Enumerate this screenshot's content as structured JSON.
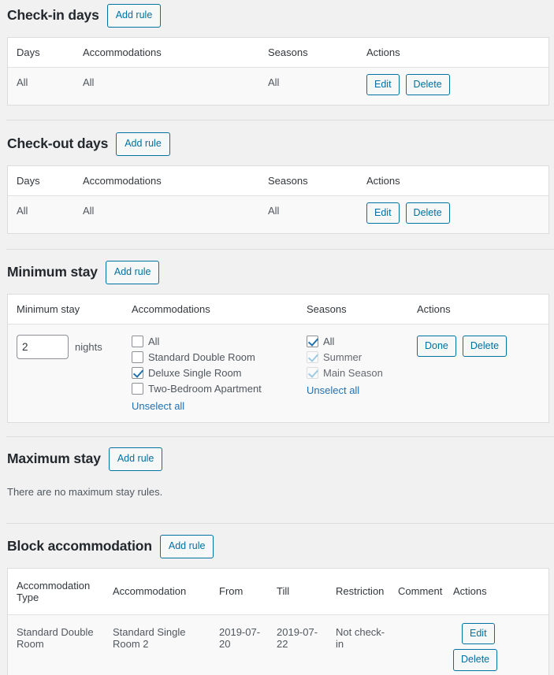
{
  "theme": {
    "page_bg": "#f1f1f1",
    "accent": "#0071a1",
    "link": "#2271b1",
    "table_border": "#dcdcdc",
    "row_bg": "#f9f9f9"
  },
  "add_rule_label": "Add rule",
  "sections": {
    "checkin": {
      "title": "Check-in days",
      "add_rule": "Add rule",
      "headers": [
        "Days",
        "Accommodations",
        "Seasons",
        "Actions"
      ],
      "rows": [
        {
          "days": "All",
          "accommodations": "All",
          "seasons": "All",
          "edit": "Edit",
          "delete": "Delete"
        }
      ]
    },
    "checkout": {
      "title": "Check-out days",
      "add_rule": "Add rule",
      "headers": [
        "Days",
        "Accommodations",
        "Seasons",
        "Actions"
      ],
      "rows": [
        {
          "days": "All",
          "accommodations": "All",
          "seasons": "All",
          "edit": "Edit",
          "delete": "Delete"
        }
      ]
    },
    "minimum_stay": {
      "title": "Minimum stay",
      "add_rule": "Add rule",
      "headers": [
        "Minimum stay",
        "Accommodations",
        "Seasons",
        "Actions"
      ],
      "row": {
        "nights_value": "2",
        "nights_placeholder": "",
        "nights_label": "nights",
        "accommodations": {
          "options": [
            {
              "label": "All",
              "checked": false,
              "disabled": false
            },
            {
              "label": "Standard Double Room",
              "checked": false,
              "disabled": false
            },
            {
              "label": "Deluxe Single Room",
              "checked": true,
              "disabled": false
            },
            {
              "label": "Two-Bedroom Apartment",
              "checked": false,
              "disabled": false
            }
          ],
          "unselect_all": "Unselect all"
        },
        "seasons": {
          "options": [
            {
              "label": "All",
              "checked": true,
              "disabled": false
            },
            {
              "label": "Summer",
              "checked": true,
              "disabled": true
            },
            {
              "label": "Main Season",
              "checked": true,
              "disabled": true
            }
          ],
          "unselect_all": "Unselect all"
        },
        "done": "Done",
        "delete": "Delete"
      }
    },
    "maximum_stay": {
      "title": "Maximum stay",
      "add_rule": "Add rule",
      "empty_message": "There are no maximum stay rules."
    },
    "block_accommodation": {
      "title": "Block accommodation",
      "add_rule": "Add rule",
      "headers": [
        "Accommodation Type",
        "Accommodation",
        "From",
        "Till",
        "Restriction",
        "Comment",
        "Actions"
      ],
      "rows": [
        {
          "accommodation_type": "Standard Double Room",
          "accommodation": "Standard Single Room 2",
          "from": "2019-07-20",
          "till": "2019-07-22",
          "restriction": "Not check-in",
          "comment": "",
          "edit": "Edit",
          "delete": "Delete"
        }
      ]
    }
  }
}
